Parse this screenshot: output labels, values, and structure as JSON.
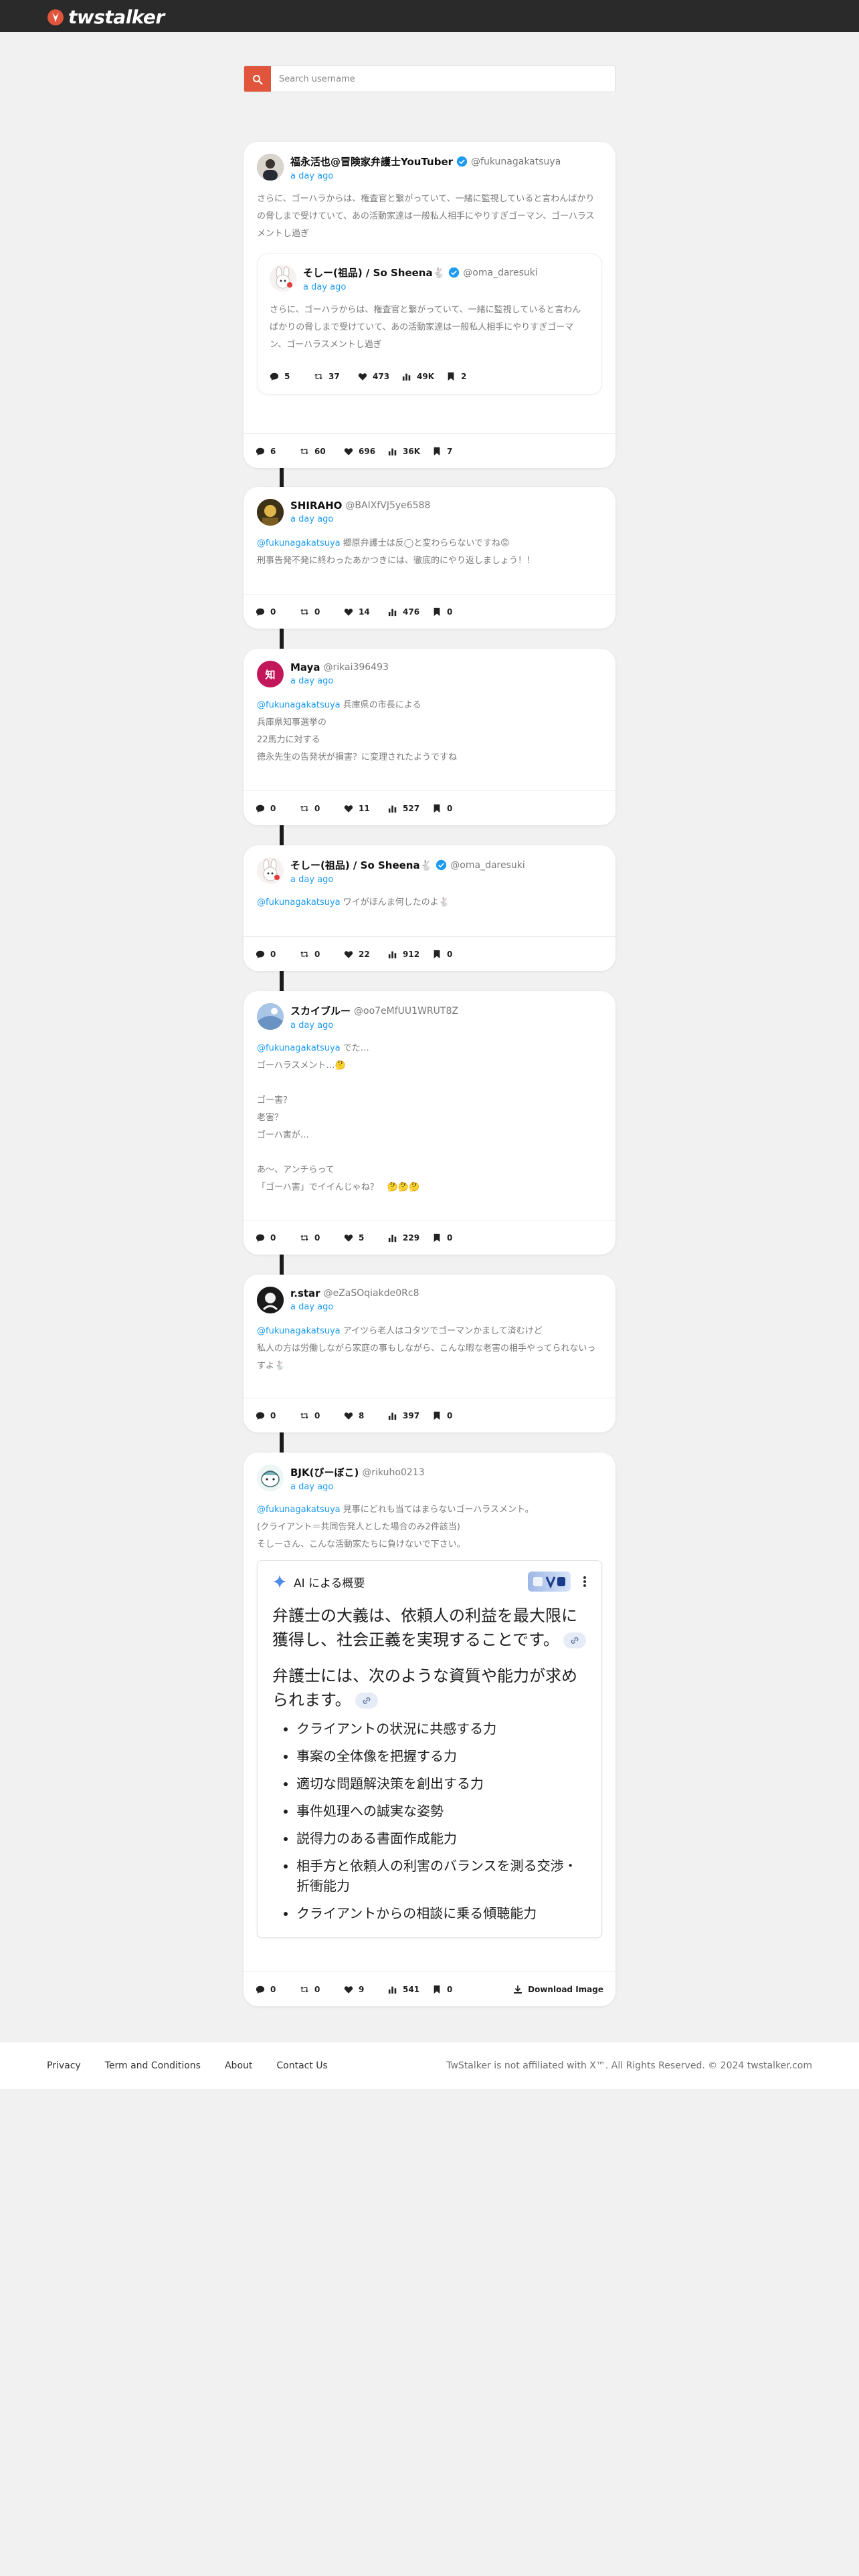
{
  "brand": {
    "name": "twstalker"
  },
  "search": {
    "placeholder": "Search username"
  },
  "main_post": {
    "name": "福永活也@冒険家弁護士YouTuber",
    "handle": "@fukunagakatsuya",
    "time": "a day ago",
    "text": "さらに、ゴーハラからは、権査官と繋がっていて、一緒に監視していると言わんばかりの脅しまで受けていて、あの活動家達は一般私人相手にやりすぎゴーマン、ゴーハラスメントし過ぎ",
    "quote": {
      "name": "そしー(祖品) / So Sheena🐇",
      "handle": "@oma_daresuki",
      "time": "a day ago",
      "text": "さらに、ゴーハラからは、権査官と繋がっていて、一緒に監視していると言わんばかりの脅しまで受けていて、あの活動家達は一般私人相手にやりすぎゴーマン、ゴーハラスメントし過ぎ",
      "stats": {
        "replies": "5",
        "retweets": "37",
        "likes": "473",
        "views": "49K",
        "bookmarks": "2"
      }
    },
    "stats": {
      "replies": "6",
      "retweets": "60",
      "likes": "696",
      "views": "36K",
      "bookmarks": "7"
    }
  },
  "replies": [
    {
      "name": "SHIRAHO",
      "handle": "@BAIXfVJ5ye6588",
      "time": "a day ago",
      "mention": "@fukunagakatsuya",
      "text": " 郷原弁護士は反◯と変わららないですね😡\n刑事告発不発に終わったあかつきには、徹底的にやり返しましょう！！",
      "stats": {
        "replies": "0",
        "retweets": "0",
        "likes": "14",
        "views": "476",
        "bookmarks": "0"
      }
    },
    {
      "name": "Maya",
      "handle": "@rikai396493",
      "time": "a day ago",
      "avatar_text": "知",
      "mention": "@fukunagakatsuya",
      "text": " 兵庫県の市長による\n兵庫県知事選挙の\n22馬力に対する\n徳永先生の告発状が損害？に変理されたようですね",
      "stats": {
        "replies": "0",
        "retweets": "0",
        "likes": "11",
        "views": "527",
        "bookmarks": "0"
      }
    },
    {
      "name": "そしー(祖品) / So Sheena🐇",
      "handle": "@oma_daresuki",
      "time": "a day ago",
      "mention": "@fukunagakatsuya",
      "text": " ワイがほんま何したのよ🐇",
      "stats": {
        "replies": "0",
        "retweets": "0",
        "likes": "22",
        "views": "912",
        "bookmarks": "0"
      }
    },
    {
      "name": "スカイブルー",
      "handle": "@oo7eMfUU1WRUT8Z",
      "time": "a day ago",
      "mention": "@fukunagakatsuya",
      "text": " でた…\nゴーハラスメント…🤔\n\nゴー害？\n老害？\nゴーハ害が…\n\nあ〜、アンチらって\n「ゴーハ害」でイイんじゃね？　🤔🤔🤔",
      "stats": {
        "replies": "0",
        "retweets": "0",
        "likes": "5",
        "views": "229",
        "bookmarks": "0"
      }
    },
    {
      "name": "r.star",
      "handle": "@eZaSOqiakde0Rc8",
      "time": "a day ago",
      "mention": "@fukunagakatsuya",
      "text": " アイツら老人はコタツでゴーマンかまして済むけど\n私人の方は労働しながら家庭の事もしながら、こんな暇な老害の相手やってられないっすよ🐇",
      "stats": {
        "replies": "0",
        "retweets": "0",
        "likes": "8",
        "views": "397",
        "bookmarks": "0"
      }
    },
    {
      "name": "BJK(びーぼこ)",
      "handle": "@rikuho0213",
      "time": "a day ago",
      "mention": "@fukunagakatsuya",
      "text": " 見事にどれも当てはまらないゴーハラスメント。\n(クライアント＝共同告発人とした場合のみ2件該当)\nそしーさん、こんな活動家たちに負けないで下さい。",
      "ai": {
        "title": "AI による概要",
        "heading1": "弁護士の大義は、依頼人の利益を最大限に獲得し、社会正義を実現することです。",
        "heading2": "弁護士には、次のような資質や能力が求められます。",
        "items": [
          "クライアントの状況に共感する力",
          "事案の全体像を把握する力",
          "適切な問題解決策を創出する力",
          "事件処理への誠実な姿勢",
          "説得力のある書面作成能力",
          "相手方と依頼人の利害のバランスを測る交渉・折衝能力",
          "クライアントからの相談に乗る傾聴能力"
        ]
      },
      "download_label": "Download Image",
      "stats": {
        "replies": "0",
        "retweets": "0",
        "likes": "9",
        "views": "541",
        "bookmarks": "0"
      }
    }
  ],
  "footer": {
    "links": [
      "Privacy",
      "Term and Conditions",
      "About",
      "Contact Us"
    ],
    "copyright": "TwStalker is not affiliated with X™. All Rights Reserved. © 2024 twstalker.com"
  },
  "colors": {
    "accent": "#1d9bf0",
    "topbar": "#2a2a2a",
    "search_button": "#e0553b",
    "background": "#f1f1f1"
  }
}
